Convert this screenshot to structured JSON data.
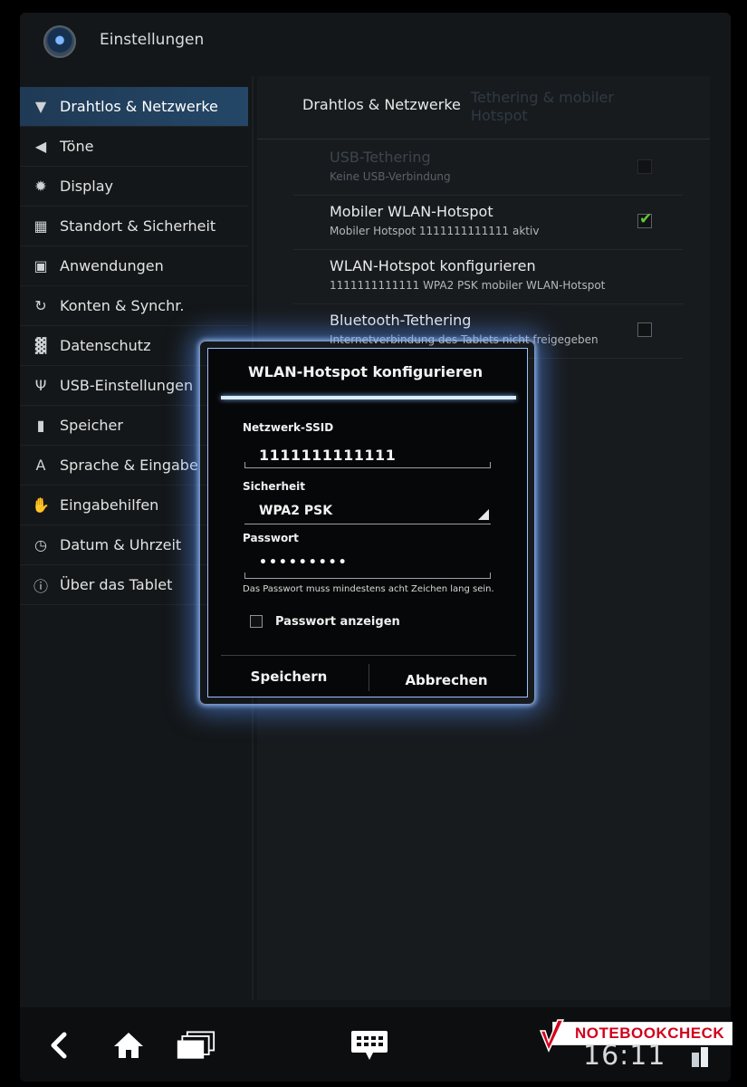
{
  "app": {
    "title": "Einstellungen",
    "icon": "settings-app-icon"
  },
  "sidebar": {
    "items": [
      {
        "label": "Drahtlos & Netzwerke",
        "icon": "wifi-icon",
        "glyph": "▼",
        "active": true
      },
      {
        "label": "Töne",
        "icon": "speaker-icon",
        "glyph": "◀"
      },
      {
        "label": "Display",
        "icon": "brightness-icon",
        "glyph": "✹"
      },
      {
        "label": "Standort & Sicherheit",
        "icon": "grid-icon",
        "glyph": "▦"
      },
      {
        "label": "Anwendungen",
        "icon": "apps-icon",
        "glyph": "▣"
      },
      {
        "label": "Konten & Synchr.",
        "icon": "sync-icon",
        "glyph": "↻"
      },
      {
        "label": "Datenschutz",
        "icon": "privacy-icon",
        "glyph": "▓"
      },
      {
        "label": "USB-Einstellungen",
        "icon": "usb-icon",
        "glyph": "Ψ"
      },
      {
        "label": "Speicher",
        "icon": "sdcard-icon",
        "glyph": "▮"
      },
      {
        "label": "Sprache & Eingabe",
        "icon": "language-icon",
        "glyph": "A"
      },
      {
        "label": "Eingabehilfen",
        "icon": "hand-icon",
        "glyph": "✋"
      },
      {
        "label": "Datum & Uhrzeit",
        "icon": "clock-icon",
        "glyph": "◷"
      },
      {
        "label": "Über das Tablet",
        "icon": "info-icon",
        "glyph": "ⓘ"
      }
    ]
  },
  "panel": {
    "tabs": [
      "Drahtlos & Netzwerke",
      "Tethering & mobiler Hotspot"
    ],
    "prefs": [
      {
        "title": "USB-Tethering",
        "summary": "Keine USB-Verbindung",
        "checked": false,
        "disabled": true
      },
      {
        "title": "Mobiler WLAN-Hotspot",
        "summary": "Mobiler Hotspot 1111111111111 aktiv",
        "checked": true,
        "disabled": false
      },
      {
        "title": "WLAN-Hotspot konfigurieren",
        "summary": "1111111111111 WPA2 PSK mobiler WLAN-Hotspot",
        "checked": null,
        "disabled": false
      },
      {
        "title": "Bluetooth-Tethering",
        "summary": "Internetverbindung des Tablets nicht freigegeben",
        "checked": false,
        "disabled": false
      }
    ]
  },
  "dialog": {
    "title": "WLAN-Hotspot konfigurieren",
    "ssid_label": "Netzwerk-SSID",
    "ssid_value": "1111111111111",
    "security_label": "Sicherheit",
    "security_value": "WPA2 PSK",
    "password_label": "Passwort",
    "password_value": "•••••••••",
    "password_hint": "Das Passwort muss mindestens acht Zeichen lang sein.",
    "show_password_label": "Passwort anzeigen",
    "show_password_checked": false,
    "save_label": "Speichern",
    "cancel_label": "Abbrechen"
  },
  "sysbar": {
    "back_icon": "back-icon",
    "home_icon": "home-icon",
    "recents_icon": "recent-apps-icon",
    "keyboard_icon": "keyboard-icon",
    "time": "16:11"
  },
  "watermark": {
    "text": "NOTEBOOKCHECK"
  },
  "colors": {
    "accent": "#244767",
    "check": "#64c832",
    "dialog_glow": "#7fb6ff"
  }
}
